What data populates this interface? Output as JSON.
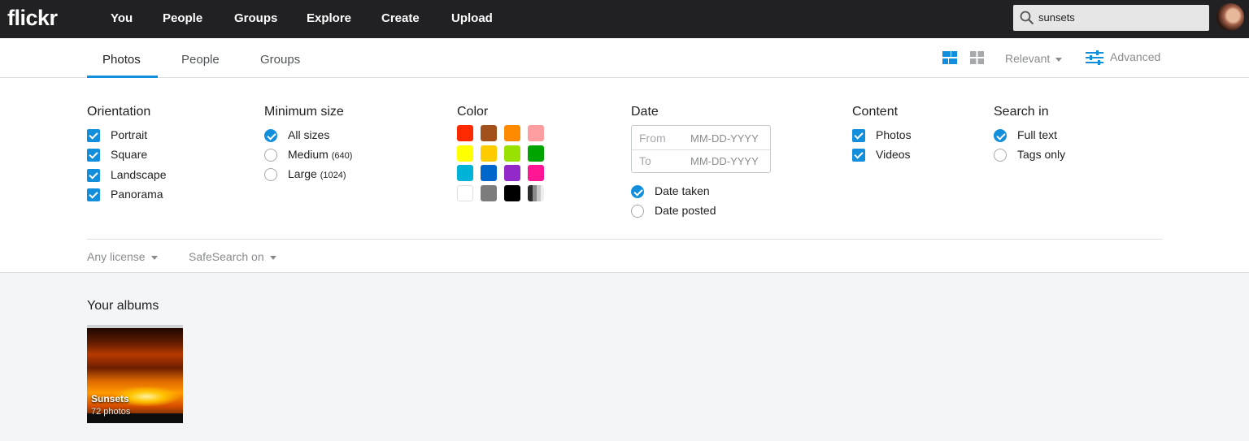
{
  "brand": {
    "logo": "flickr"
  },
  "topnav": {
    "links": [
      "You",
      "People",
      "Groups",
      "Explore",
      "Create",
      "Upload"
    ],
    "search_value": "sunsets"
  },
  "subnav": {
    "tabs": [
      "Photos",
      "People",
      "Groups"
    ],
    "active_tab": "Photos",
    "sort_label": "Relevant",
    "advanced_label": "Advanced"
  },
  "filters": {
    "orientation": {
      "title": "Orientation",
      "options": [
        {
          "label": "Portrait",
          "checked": true
        },
        {
          "label": "Square",
          "checked": true
        },
        {
          "label": "Landscape",
          "checked": true
        },
        {
          "label": "Panorama",
          "checked": true
        }
      ]
    },
    "min_size": {
      "title": "Minimum size",
      "options": [
        {
          "label": "All sizes",
          "note": "",
          "selected": true
        },
        {
          "label": "Medium",
          "note": "(640)",
          "selected": false
        },
        {
          "label": "Large",
          "note": "(1024)",
          "selected": false
        }
      ]
    },
    "color": {
      "title": "Color",
      "swatches": [
        "#ff2a00",
        "#a2511c",
        "#ff8a00",
        "#ff9ea1",
        "#ffff00",
        "#ffcc00",
        "#99e100",
        "#00a400",
        "#00b3d7",
        "#0066cc",
        "#9329c9",
        "#ff1694",
        "#ffffff",
        "#7c7c7c",
        "#000000",
        "gradient"
      ]
    },
    "date": {
      "title": "Date",
      "from_label": "From",
      "to_label": "To",
      "from_placeholder": "MM-DD-YYYY",
      "to_placeholder": "MM-DD-YYYY",
      "options": [
        {
          "label": "Date taken",
          "selected": true
        },
        {
          "label": "Date posted",
          "selected": false
        }
      ]
    },
    "content": {
      "title": "Content",
      "options": [
        {
          "label": "Photos",
          "checked": true
        },
        {
          "label": "Videos",
          "checked": true
        }
      ]
    },
    "search_in": {
      "title": "Search in",
      "options": [
        {
          "label": "Full text",
          "selected": true
        },
        {
          "label": "Tags only",
          "selected": false
        }
      ]
    },
    "license_label": "Any license",
    "safesearch_label": "SafeSearch on"
  },
  "albums": {
    "title": "Your albums",
    "items": [
      {
        "name": "Sunsets",
        "count": "72 photos"
      }
    ]
  },
  "colors": {
    "accent": "#128fdc",
    "topbar": "#212124"
  }
}
